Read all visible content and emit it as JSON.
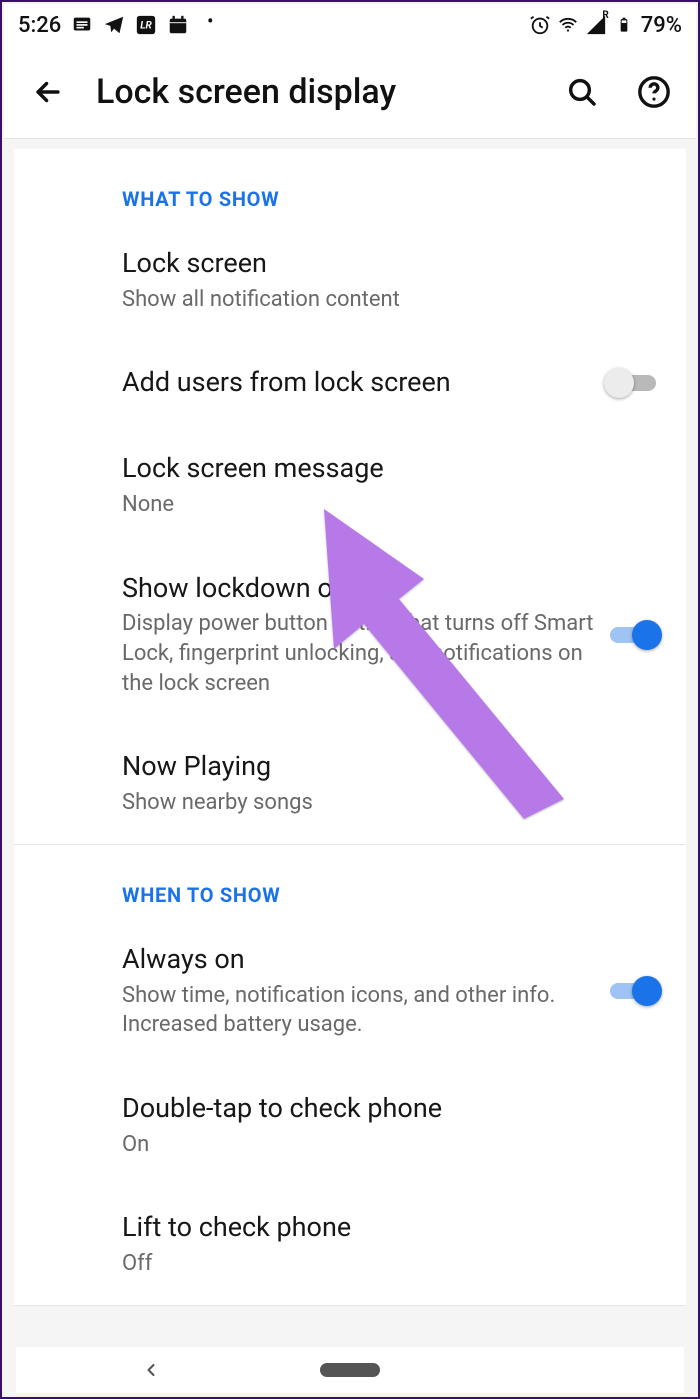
{
  "status": {
    "time": "5:26",
    "battery": "79%"
  },
  "header": {
    "title": "Lock screen display"
  },
  "sections": [
    {
      "header": "WHAT TO SHOW",
      "items": [
        {
          "title": "Lock screen",
          "sub": "Show all notification content"
        },
        {
          "title": "Add users from lock screen",
          "sub": "",
          "toggle": false
        },
        {
          "title": "Lock screen message",
          "sub": "None"
        },
        {
          "title": "Show lockdown option",
          "sub": "Display power button option that turns off Smart Lock, fingerprint unlocking, and notifications on the lock screen",
          "toggle": true
        },
        {
          "title": "Now Playing",
          "sub": "Show nearby songs"
        }
      ]
    },
    {
      "header": "WHEN TO SHOW",
      "items": [
        {
          "title": "Always on",
          "sub": "Show time, notification icons, and other info. Increased battery usage.",
          "toggle": true
        },
        {
          "title": "Double-tap to check phone",
          "sub": "On"
        },
        {
          "title": "Lift to check phone",
          "sub": "Off"
        }
      ]
    }
  ]
}
